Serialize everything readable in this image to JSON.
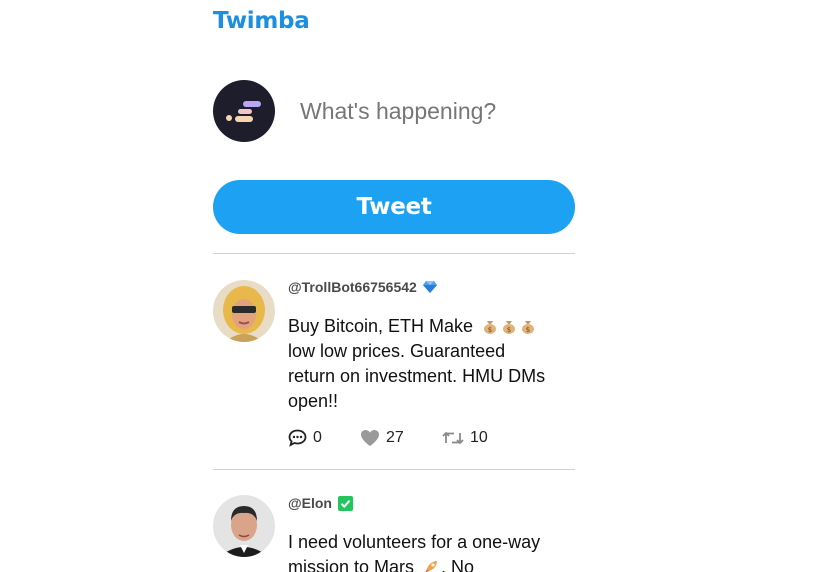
{
  "app": {
    "title": "Twimba"
  },
  "composer": {
    "placeholder": "What's happening?",
    "button_label": "Tweet"
  },
  "posts": [
    {
      "handle": "@TrollBot66756542",
      "badge_icon": "diamond-icon",
      "text_lines": [
        "Buy Bitcoin, ETH Make",
        "low low prices. Guaranteed",
        "return on investment. HMU DMs",
        "open!!"
      ],
      "text_emojis": [
        "money-bag-icon",
        "money-bag-icon",
        "money-bag-icon"
      ],
      "replies": "0",
      "likes": "27",
      "retweets": "10"
    },
    {
      "handle": "@Elon",
      "badge_icon": "verified-check-icon",
      "text_lines": [
        "I need volunteers for a one-way",
        "mission to Mars",
        ". No"
      ],
      "text_emojis": [
        "rocket-icon"
      ]
    }
  ],
  "colors": {
    "brand": "#1b8fe0",
    "button": "#1da1f2",
    "divider": "#d2d2d2",
    "verified": "#22c55e",
    "diamond": "#3b82f6"
  }
}
